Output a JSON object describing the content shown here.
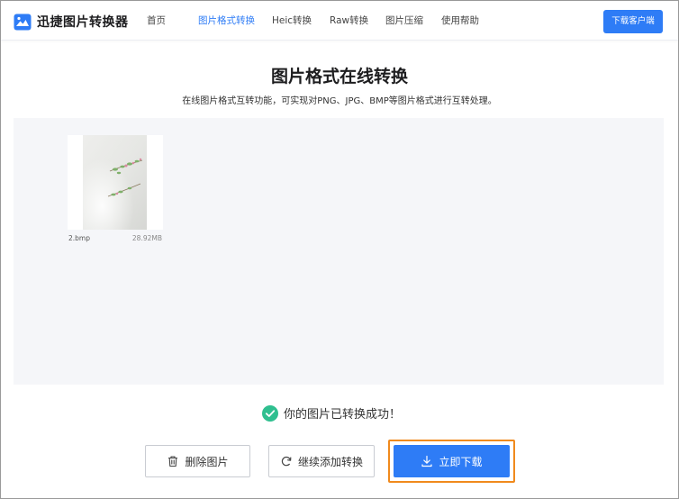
{
  "header": {
    "logo_text": "迅捷图片转换器",
    "nav": [
      {
        "label": "首页",
        "active": false
      },
      {
        "label": "图片格式转换",
        "active": true
      },
      {
        "label": "Heic转换",
        "active": false
      },
      {
        "label": "Raw转换",
        "active": false
      },
      {
        "label": "图片压缩",
        "active": false
      },
      {
        "label": "使用帮助",
        "active": false
      }
    ],
    "download_client_label": "下载客户端"
  },
  "main": {
    "title": "图片格式在线转换",
    "subtitle": "在线图片格式互转功能，可实现对PNG、JPG、BMP等图片格式进行互转处理。"
  },
  "file": {
    "name": "2.bmp",
    "size": "28.92MB"
  },
  "status": {
    "message": "你的图片已转换成功！"
  },
  "actions": {
    "delete_label": "删除图片",
    "continue_label": "继续添加转换",
    "download_label": "立即下载"
  },
  "colors": {
    "accent": "#2e7cf6",
    "success": "#2fbf8f",
    "highlight": "#f08a1d"
  }
}
